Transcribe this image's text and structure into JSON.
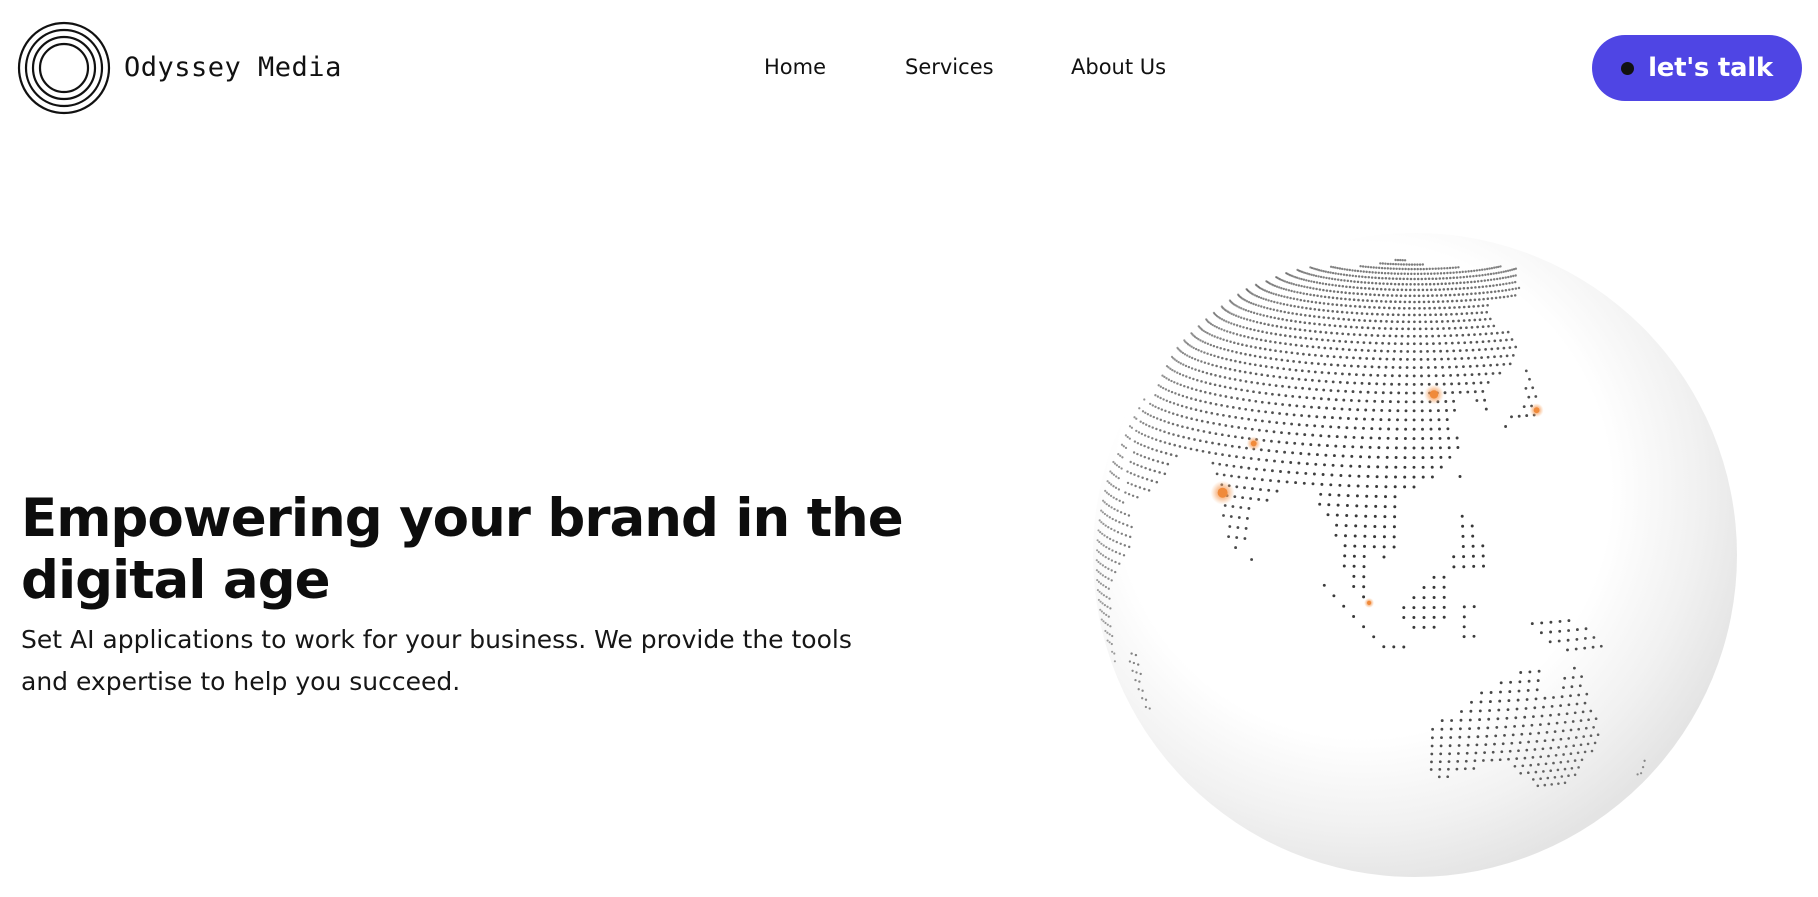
{
  "header": {
    "brand": "Odyssey Media",
    "logo_icon": "concentric-circles-icon",
    "nav": {
      "home": "Home",
      "services": "Services",
      "about": "About Us"
    },
    "cta_label": "let's talk",
    "cta_icon": "dot-icon"
  },
  "hero": {
    "title": "Empowering your brand in the digital age",
    "subtitle": "Set AI applications to work for your business. We provide the tools and expertise to help you succeed."
  },
  "globe": {
    "icon": "dotted-globe-icon",
    "region": "Asia and Australia",
    "highlight_locations": [
      "Mumbai",
      "Delhi",
      "Beijing",
      "Tokyo",
      "Singapore"
    ]
  },
  "colors": {
    "accent": "#4f45e4",
    "text": "#111111",
    "background": "#ffffff",
    "globe_dot": "#2a2a2a",
    "globe_highlight": "#f08a3a"
  }
}
